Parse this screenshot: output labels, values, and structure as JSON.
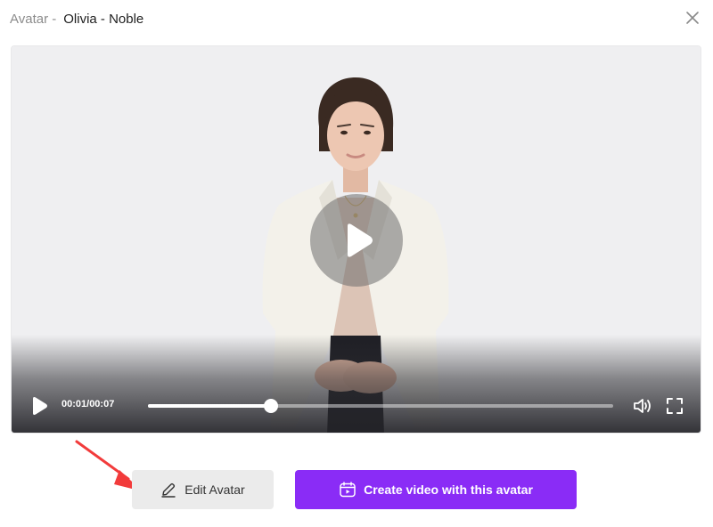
{
  "dialog": {
    "title_prefix": "Avatar -",
    "avatar_name": "Olivia - Noble"
  },
  "player": {
    "current_time": "00:01",
    "duration": "00:07",
    "time_display": "00:01/00:07",
    "progress": 0.265
  },
  "actions": {
    "edit_label": "Edit Avatar",
    "create_label": "Create video with this avatar"
  },
  "icons": [
    "close-icon",
    "play-icon",
    "volume-icon",
    "fullscreen-icon",
    "pencil-icon",
    "video-camera-icon",
    "red-arrow-annotation"
  ],
  "colors": {
    "primary": "#8a2cf6",
    "secondary_button": "#ebebeb",
    "annotation": "#f23b3b"
  }
}
